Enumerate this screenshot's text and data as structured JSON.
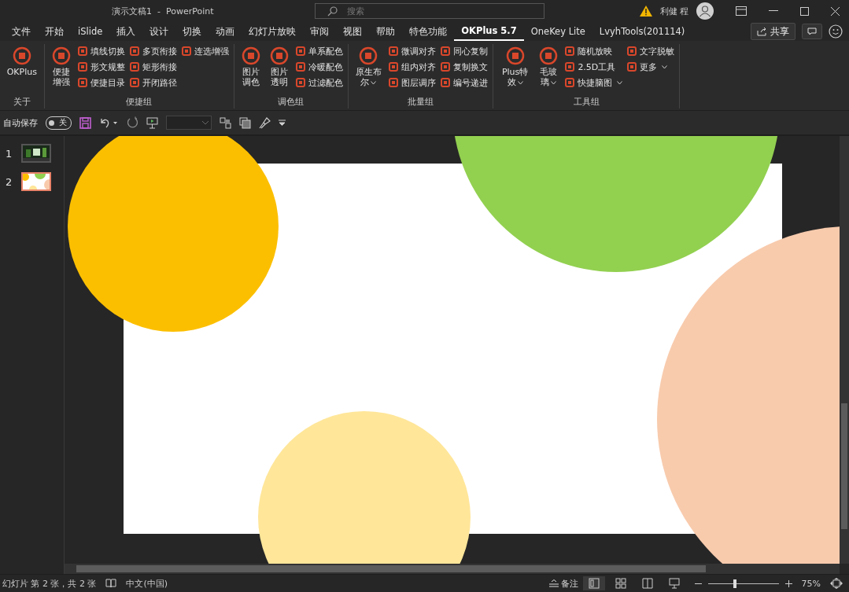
{
  "window": {
    "title": "演示文稿1  -  PowerPoint",
    "search_placeholder": "搜索",
    "user": "利健 程",
    "warning": true
  },
  "tabs": [
    {
      "label": "文件",
      "selected": false
    },
    {
      "label": "开始",
      "selected": false
    },
    {
      "label": "iSlide",
      "selected": false
    },
    {
      "label": "插入",
      "selected": false
    },
    {
      "label": "设计",
      "selected": false
    },
    {
      "label": "切换",
      "selected": false
    },
    {
      "label": "动画",
      "selected": false
    },
    {
      "label": "幻灯片放映",
      "selected": false
    },
    {
      "label": "审阅",
      "selected": false
    },
    {
      "label": "视图",
      "selected": false
    },
    {
      "label": "帮助",
      "selected": false
    },
    {
      "label": "特色功能",
      "selected": false
    },
    {
      "label": "OKPlus 5.7",
      "selected": true
    },
    {
      "label": "OneKey Lite",
      "selected": false
    },
    {
      "label": "LvyhTools(201114)",
      "selected": false
    }
  ],
  "share_button": "共享",
  "ribbon": [
    {
      "name": "关于",
      "items": [
        {
          "kind": "big",
          "label": "OKPlus",
          "dropdown": false
        }
      ]
    },
    {
      "name": "便捷组",
      "items": [
        {
          "kind": "big",
          "label": "便捷增强",
          "dropdown": false
        },
        {
          "kind": "column",
          "items": [
            {
              "label": "填线切换",
              "dropdown": false
            },
            {
              "label": "形文规整",
              "dropdown": false
            },
            {
              "label": "便捷目录",
              "dropdown": false
            }
          ]
        },
        {
          "kind": "column",
          "items": [
            {
              "label": "多页衔接",
              "dropdown": false
            },
            {
              "label": "矩形衔接",
              "dropdown": false
            },
            {
              "label": "开闭路径",
              "dropdown": false
            }
          ]
        },
        {
          "kind": "column",
          "items": [
            {
              "label": "连选增强",
              "dropdown": false
            }
          ]
        }
      ]
    },
    {
      "name": "调色组",
      "items": [
        {
          "kind": "big",
          "label": "图片调色",
          "dropdown": false
        },
        {
          "kind": "big",
          "label": "图片透明",
          "dropdown": false
        },
        {
          "kind": "column",
          "items": [
            {
              "label": "单系配色",
              "dropdown": false
            },
            {
              "label": "冷暖配色",
              "dropdown": false
            },
            {
              "label": "过滤配色",
              "dropdown": false
            }
          ]
        }
      ]
    },
    {
      "name": "批量组",
      "items": [
        {
          "kind": "big",
          "label": "原生布尔",
          "dropdown": true
        },
        {
          "kind": "column",
          "items": [
            {
              "label": "微调对齐",
              "dropdown": false
            },
            {
              "label": "组内对齐",
              "dropdown": false
            },
            {
              "label": "图层调序",
              "dropdown": false
            }
          ]
        },
        {
          "kind": "column",
          "items": [
            {
              "label": "同心复制",
              "dropdown": false
            },
            {
              "label": "复制换文",
              "dropdown": false
            },
            {
              "label": "编号递进",
              "dropdown": false
            }
          ]
        }
      ]
    },
    {
      "name": "工具组",
      "items": [
        {
          "kind": "big",
          "label": "Plus特效",
          "dropdown": true
        },
        {
          "kind": "big",
          "label": "毛玻璃",
          "dropdown": true
        },
        {
          "kind": "column",
          "items": [
            {
              "label": "随机放映",
              "dropdown": false
            },
            {
              "label": "2.5D工具",
              "dropdown": false
            },
            {
              "label": "快捷脑图",
              "dropdown": true
            }
          ]
        },
        {
          "kind": "column",
          "items": [
            {
              "label": "文字脱敏",
              "dropdown": false
            },
            {
              "label": "更多",
              "dropdown": true
            }
          ]
        }
      ]
    }
  ],
  "quick_access": {
    "autosave_label": "自动保存",
    "autosave_toggle": {
      "label": "关",
      "on": false
    }
  },
  "slides": [
    {
      "number": "1",
      "selected": false
    },
    {
      "number": "2",
      "selected": true
    }
  ],
  "canvas_shapes": [
    {
      "kind": "circle",
      "color": "#fcbf00"
    },
    {
      "kind": "circle",
      "color": "#92d050"
    },
    {
      "kind": "circle",
      "color": "#f8cbad"
    },
    {
      "kind": "circle",
      "color": "#ffe699"
    }
  ],
  "status_bar": {
    "slide_info": "幻灯片 第 2 张，共 2 张",
    "language": "中文(中国)",
    "notes_button": "备注",
    "views": [
      {
        "kind": "normal",
        "selected": true
      },
      {
        "kind": "sorter",
        "selected": false
      },
      {
        "kind": "reading",
        "selected": false
      },
      {
        "kind": "show",
        "selected": false
      }
    ],
    "zoom": {
      "level": 0.38,
      "reading": "75%"
    }
  }
}
